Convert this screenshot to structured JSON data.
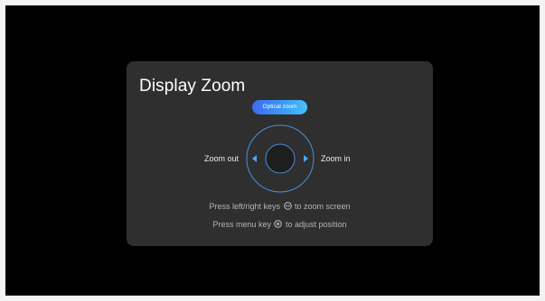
{
  "dialog": {
    "title": "Display Zoom",
    "mode_button": "Optical zoom",
    "zoom_out_label": "Zoom out",
    "zoom_in_label": "Zoom in",
    "hint_lines": [
      {
        "before": "Press left/right keys",
        "icon": "left-right-keys-icon",
        "after": "to zoom screen"
      },
      {
        "before": "Press menu key",
        "icon": "menu-key-icon",
        "after": "to adjust position"
      }
    ]
  },
  "colors": {
    "background": "#000000",
    "panel": "#2f2f2f",
    "accent_blue": "#3a9df5",
    "arrow_blue": "#4aa8ff",
    "ring_blue": "#4a8fe0"
  }
}
